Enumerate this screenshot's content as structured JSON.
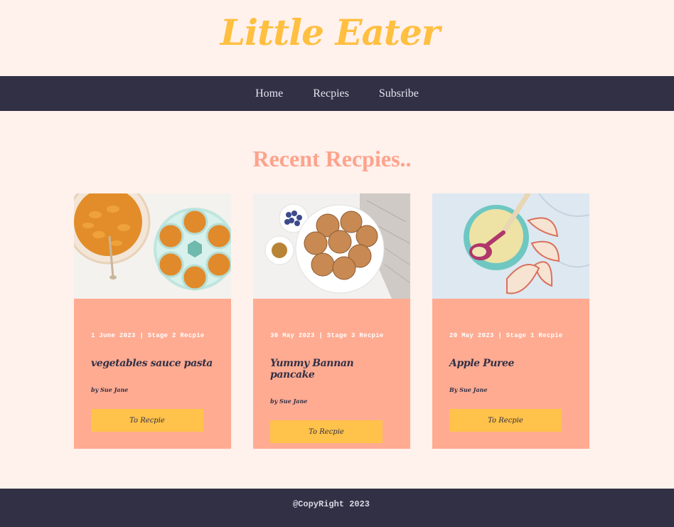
{
  "header": {
    "logo": "Little Eater"
  },
  "nav": {
    "items": [
      "Home",
      "Recpies",
      "Subsribe"
    ]
  },
  "main": {
    "title": "Recent Recpies..",
    "cards": [
      {
        "meta": "1 June 2023 | Stage 2 Recpie",
        "title": "vegetables sauce pasta",
        "author": "by Sue Jane",
        "button": "To Recpie"
      },
      {
        "meta": "30 May 2023 | Stage 3 Recpie",
        "title": "Yummy Bannan pancake",
        "author": "by Sue Jane",
        "button": "To Recpie"
      },
      {
        "meta": "20 May 2023 | Stage 1 Recpie",
        "title": "Apple Puree",
        "author": "By Sue Jane",
        "button": "To Recpie"
      }
    ]
  },
  "footer": {
    "text": "@CopyRight 2023"
  },
  "colors": {
    "background": "#fff1ec",
    "logo": "#ffbf40",
    "nav": "#323045",
    "accent": "#fea38c",
    "card": "#feab92",
    "button": "#ffc24a"
  }
}
